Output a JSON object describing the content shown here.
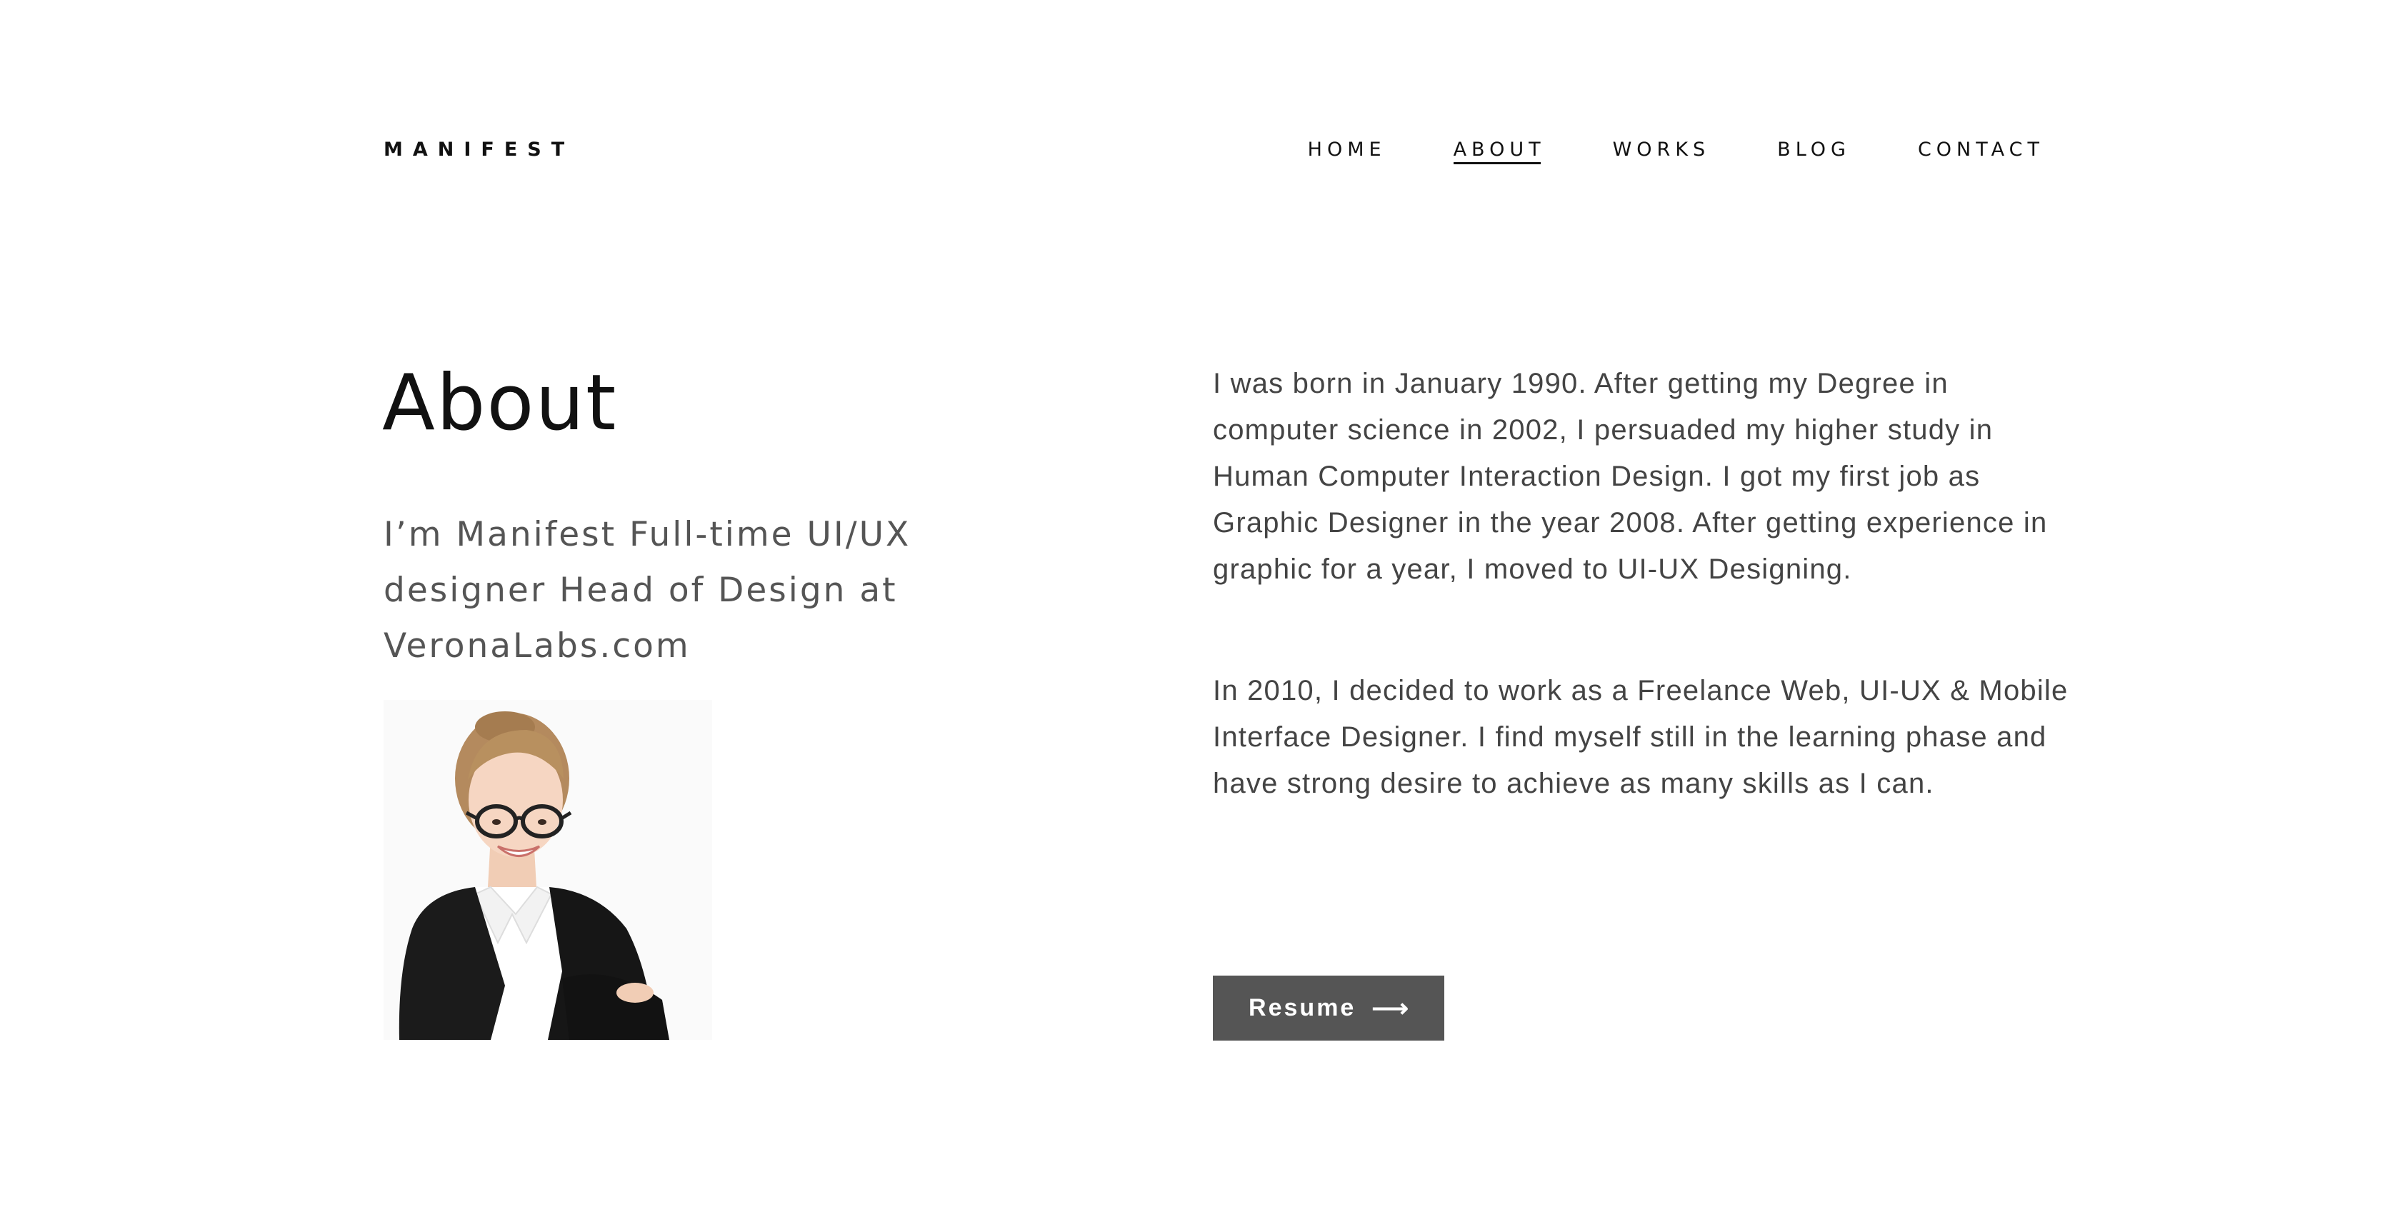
{
  "header": {
    "logo": "MANIFEST",
    "nav": [
      {
        "label": "HOME",
        "active": false
      },
      {
        "label": "ABOUT",
        "active": true
      },
      {
        "label": "WORKS",
        "active": false
      },
      {
        "label": "BLOG",
        "active": false
      },
      {
        "label": "CONTACT",
        "active": false
      }
    ]
  },
  "main": {
    "title": "About",
    "subtitle": "I’m Manifest Full-time UI/UX designer Head of Design at VeronaLabs.com",
    "portrait": {
      "icon": "portrait-photo"
    },
    "bio": [
      "I was born in January 1990. After getting my Degree in computer science in 2002, I persuaded my higher study in Human Computer Interaction Design. I got my first job as Graphic Designer in the year 2008. After getting experience in graphic for a year, I moved to UI-UX Designing.",
      "In 2010, I decided to work as a Freelance Web, UI-UX & Mobile Interface Designer. I find myself still in the learning phase and have strong desire to achieve as many skills as I can."
    ],
    "resume_button": {
      "label": "Resume",
      "icon": "arrow-right-icon"
    }
  },
  "colors": {
    "text": "#111111",
    "muted_text": "#555555",
    "body_text": "#444444",
    "button_bg": "#555555",
    "background": "#ffffff"
  }
}
